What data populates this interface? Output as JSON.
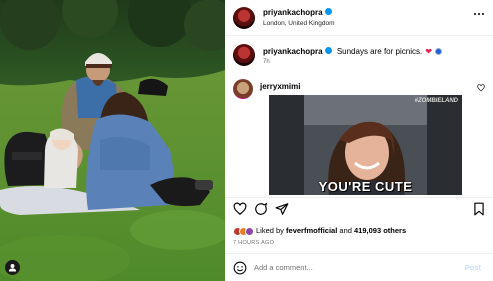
{
  "post": {
    "author": "priyankachopra",
    "location": "London, United Kingdom",
    "more_icon": "more-horizontal-icon",
    "caption": "Sundays are for picnics.",
    "caption_emojis": [
      "red-heart-emoji",
      "blue-evil-eye-emoji"
    ],
    "caption_time": "7h"
  },
  "comment": {
    "username": "jerryxmimi",
    "gif": {
      "watermark": "#ZOMBIELAND",
      "caption": "YOU'RE CUTE"
    },
    "like_icon": "heart-outline-icon"
  },
  "actions": {
    "like_icon": "heart-outline-icon",
    "comment_icon": "speech-bubble-icon",
    "share_icon": "paper-plane-icon",
    "save_icon": "bookmark-icon"
  },
  "likes": {
    "prefix": "Liked by",
    "first_user": "feverfmofficial",
    "joiner": "and",
    "count": "419,093 others"
  },
  "time_ago": "7 HOURS AGO",
  "add_comment": {
    "placeholder": "Add a comment...",
    "post_label": "Post",
    "emoji_icon": "smiley-icon"
  },
  "photo": {
    "tag_icon": "user-tag-icon"
  }
}
